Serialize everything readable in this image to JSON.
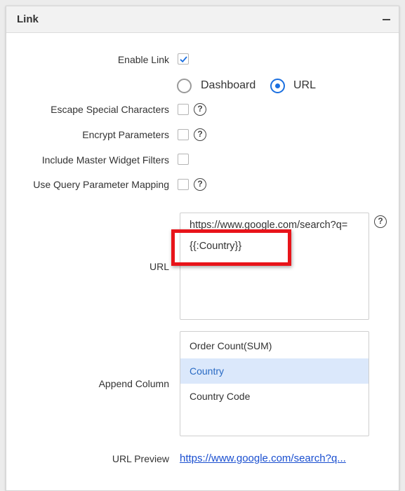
{
  "panel": {
    "title": "Link"
  },
  "settings": {
    "enable_link_label": "Enable Link",
    "enable_link_checked": true,
    "link_types": [
      {
        "label": "Dashboard",
        "selected": false
      },
      {
        "label": "URL",
        "selected": true
      }
    ],
    "escape_label": "Escape Special Characters",
    "encrypt_label": "Encrypt Parameters",
    "include_filters_label": "Include Master Widget Filters",
    "query_mapping_label": "Use Query Parameter Mapping"
  },
  "url_field": {
    "label": "URL",
    "line1": "https://www.google.com/search?q=",
    "line2": "{{:Country}}"
  },
  "append_column": {
    "label": "Append Column",
    "items": [
      {
        "label": "Order Count(SUM)",
        "selected": false
      },
      {
        "label": "Country",
        "selected": true
      },
      {
        "label": "Country Code",
        "selected": false
      }
    ]
  },
  "url_preview": {
    "label": "URL Preview",
    "text": "https://www.google.com/search?q..."
  },
  "help_glyph": "?",
  "colors": {
    "accent": "#1a6fe0",
    "highlight": "#e8141a",
    "selected_bg": "#dbe8fb",
    "link": "#1a4fd0"
  }
}
